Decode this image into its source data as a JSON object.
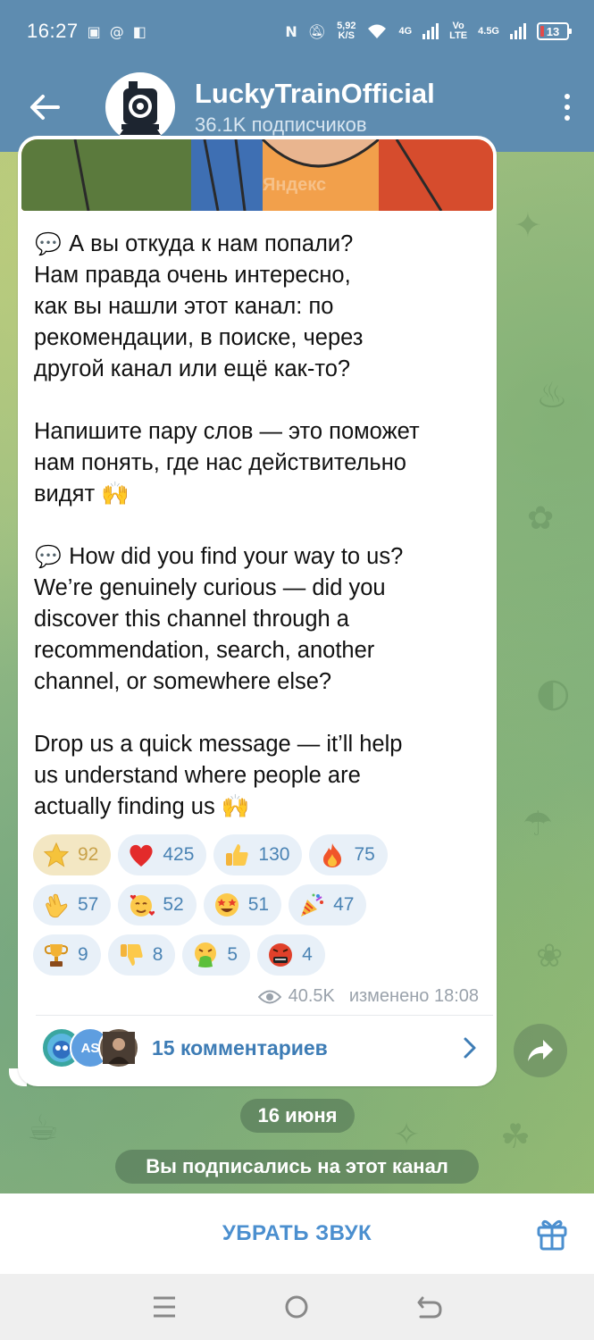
{
  "status_bar": {
    "time": "16:27",
    "net_speed_top": "5,92",
    "net_speed_bottom": "K/S",
    "sig1": "4G",
    "volte_top": "Vo",
    "volte_bottom": "LTE",
    "sig2": "4.5G",
    "battery": "13"
  },
  "header": {
    "title": "LuckyTrainOfficial",
    "subtitle": "36.1K подписчиков"
  },
  "media": {
    "watermark": "Яндекс"
  },
  "message": {
    "paragraphs": [
      {
        "prefix": "💬",
        "text": "А вы откуда к нам попали?\nНам правда очень интересно,\nкак вы нашли этот канал: по\nрекомендации, в поиске, через\nдругой канал или ещё как-то?"
      },
      {
        "prefix": "",
        "text": "Напишите пару слов — это поможет\nнам понять, где нас действительно\nвидят 🙌"
      },
      {
        "prefix": "💬",
        "text": "How did you find your way to us?\nWe’re genuinely curious — did you\ndiscover this channel through a\nrecommendation, search, another\nchannel, or somewhere else?"
      },
      {
        "prefix": "",
        "text": "Drop us a quick message — it’ll help\nus understand where people are\nactually finding us 🙌"
      }
    ]
  },
  "reactions": [
    {
      "icon": "star",
      "count": "92",
      "active": true
    },
    {
      "icon": "heart",
      "count": "425"
    },
    {
      "icon": "thumbs-up",
      "count": "130"
    },
    {
      "icon": "fire",
      "count": "75"
    },
    {
      "icon": "clap",
      "count": "57"
    },
    {
      "icon": "smiling-hearts",
      "count": "52"
    },
    {
      "icon": "star-struck",
      "count": "51"
    },
    {
      "icon": "party-popper",
      "count": "47"
    },
    {
      "icon": "trophy",
      "count": "9"
    },
    {
      "icon": "thumbs-down",
      "count": "8"
    },
    {
      "icon": "vomit",
      "count": "5"
    },
    {
      "icon": "cursing",
      "count": "4"
    }
  ],
  "meta": {
    "views": "40.5K",
    "edited": "изменено 18:08"
  },
  "comments": {
    "label": "15 комментариев",
    "avatar_initials": "AS"
  },
  "service": {
    "date": "16 июня",
    "joined": "Вы подписались на этот канал"
  },
  "bottom_bar": {
    "mute_label": "УБРАТЬ ЗВУК"
  },
  "colors": {
    "header": "#5e8cb0",
    "accent": "#3d7cb5",
    "reaction_bg": "#e8f0f8",
    "reaction_active_bg": "#f3e7c3"
  }
}
